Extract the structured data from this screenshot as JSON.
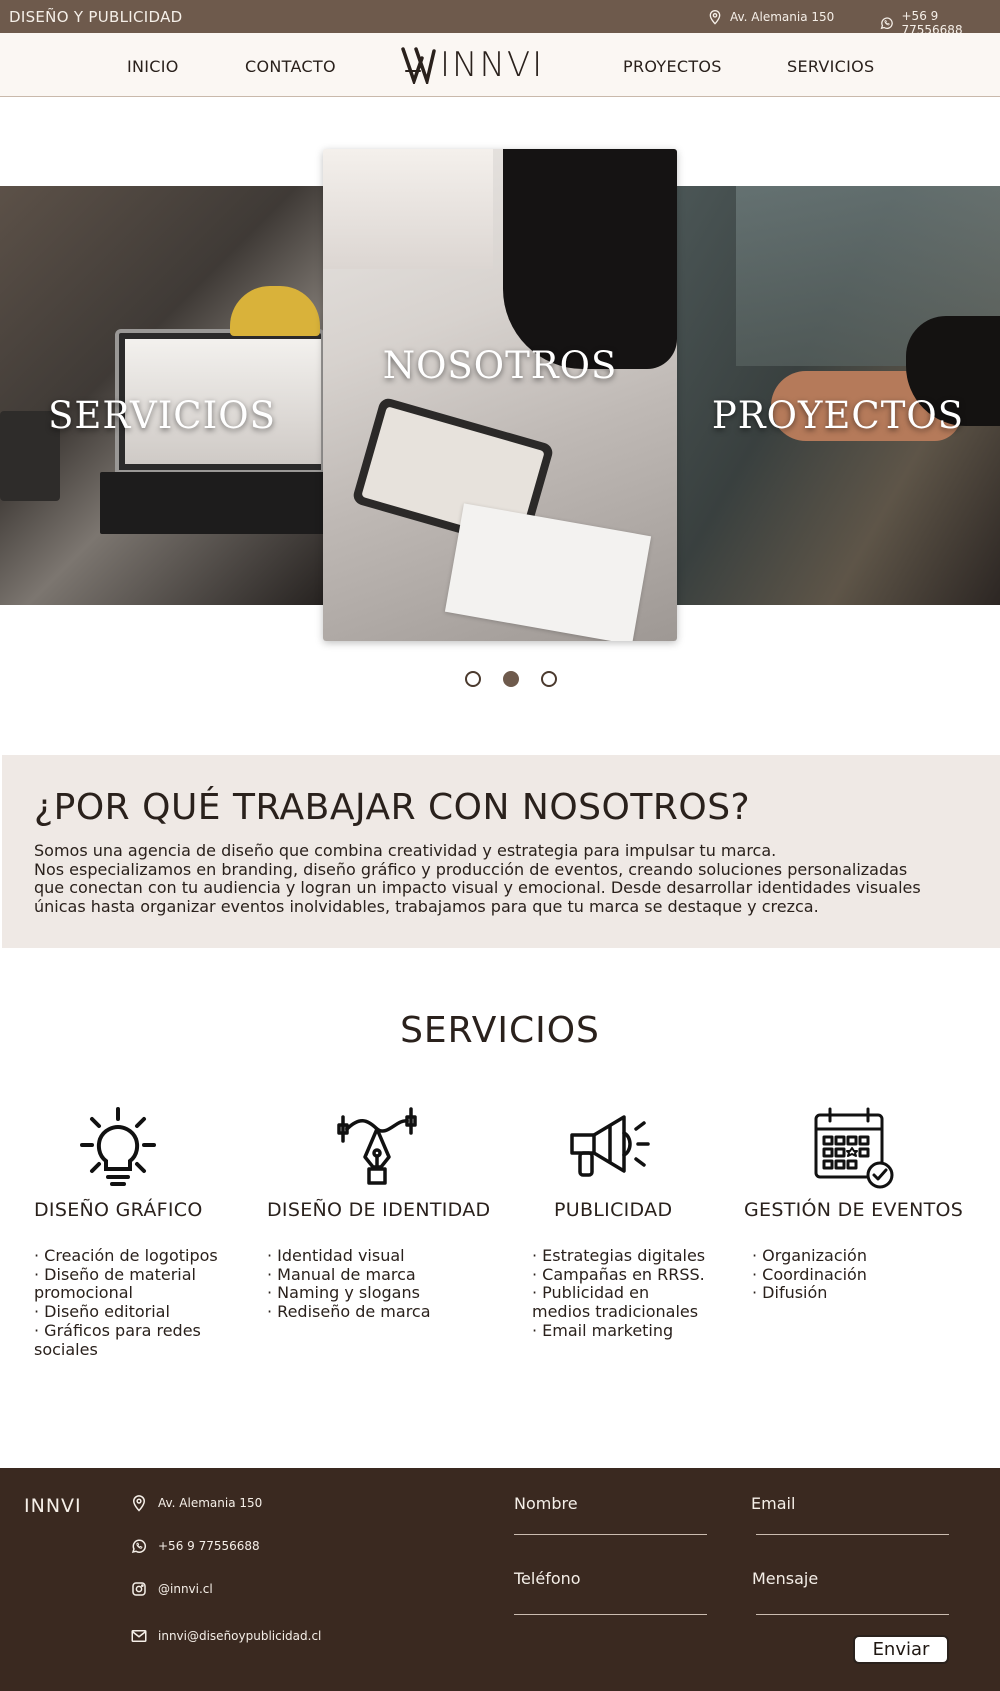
{
  "topbar": {
    "brand": "DISEÑO Y PUBLICIDAD",
    "address": "Av. Alemania 150",
    "phone": "+56 9 77556688"
  },
  "nav": {
    "items": [
      "INICIO",
      "CONTACTO",
      "PROYECTOS",
      "SERVICIOS"
    ],
    "logo_text": "INNVI"
  },
  "carousel": {
    "slides": [
      "SERVICIOS",
      "NOSOTROS",
      "PROYECTOS"
    ],
    "active_index": 1,
    "dot_count": 3
  },
  "why": {
    "title": "¿POR QUÉ TRABAJAR CON NOSOTROS?",
    "line1": "Somos una agencia de diseño que combina creatividad y estrategia para impulsar tu marca.",
    "line2": "Nos especializamos en branding, diseño gráfico y producción de eventos, creando soluciones personalizadas",
    "line3": "que conectan con tu audiencia y logran un impacto visual y emocional. Desde desarrollar identidades visuales",
    "line4": "únicas hasta organizar eventos inolvidables, trabajamos para que tu marca se destaque y crezca."
  },
  "services": {
    "title": "SERVICIOS",
    "items": [
      {
        "icon": "lightbulb-icon",
        "title": "DISEÑO GRÁFICO",
        "bullets": [
          "· Creación de logotipos",
          "·  Diseño de material",
          "promocional",
          "· Diseño editorial",
          "· Gráficos para redes",
          "sociales"
        ]
      },
      {
        "icon": "pen-tool-icon",
        "title": "DISEÑO DE IDENTIDAD",
        "bullets": [
          "· Identidad visual",
          "· Manual de marca",
          "· Naming y slogans",
          "· Rediseño de marca"
        ]
      },
      {
        "icon": "megaphone-icon",
        "title": "PUBLICIDAD",
        "bullets": [
          "· Estrategias digitales",
          "· Campañas en RRSS.",
          "· Publicidad en",
          "medios tradicionales",
          "· Email marketing"
        ]
      },
      {
        "icon": "calendar-icon",
        "title": "GESTIÓN DE EVENTOS",
        "bullets": [
          "· Organización",
          "· Coordinación",
          "· Difusión"
        ]
      }
    ]
  },
  "footer": {
    "logo": "INNVI",
    "address": "Av. Alemania 150",
    "phone": "+56 9 77556688",
    "instagram": "@innvi.cl",
    "email": "innvi@diseñoypublicidad.cl",
    "form": {
      "name_label": "Nombre",
      "email_label": "Email",
      "phone_label": "Teléfono",
      "message_label": "Mensaje",
      "submit_label": "Enviar"
    }
  },
  "colors": {
    "topbar": "#6e5a4c",
    "nav_bg": "#fbf7f3",
    "why_bg": "#efe9e5",
    "footer_bg": "#3a2920"
  }
}
